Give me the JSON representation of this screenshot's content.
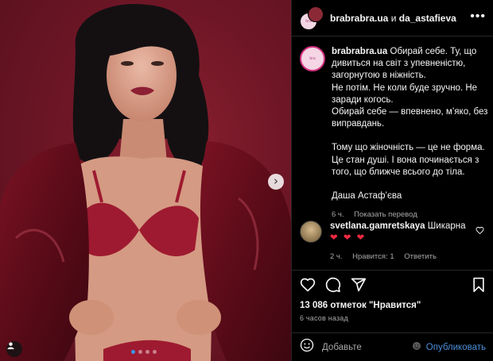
{
  "post": {
    "photo_alt": "",
    "next_glyph": "›",
    "slide_count": 4,
    "active_slide": 1
  },
  "header": {
    "user1": "brabrabra.ua",
    "joiner": "и",
    "user2": "da_astafieva",
    "more_glyph": "•••"
  },
  "caption": {
    "username": "brabrabra.ua",
    "paragraph1": [
      "Обирай себе. Ту, що дивиться на світ з упевненістю, загорнутою в ніжність.",
      "Не потім. Не коли буде зручно. Не заради когось.",
      "Обирай себе — впевнено, м’яко, без виправдань."
    ],
    "paragraph2": "Тому що жіночність — це не форма. Це стан душі. І вона починається з того, що ближче всього до тіла.",
    "signature": "Даша Астаф’єва",
    "age": "6 ч.",
    "translate": "Показать перевод"
  },
  "comment": {
    "username": "svetlana.gamretskaya",
    "text": "Шикарна",
    "hearts": "❤ ❤ ❤",
    "age": "2 ч.",
    "likes": "Нравится: 1",
    "reply": "Ответить"
  },
  "likes_text": "13 086 отметок \"Нравится\"",
  "timestamp": "6 часов назад",
  "add_comment": {
    "placeholder": "Добавьте",
    "post_label": "Опубликовать"
  },
  "icons": [
    "heart-icon",
    "comment-icon",
    "share-icon",
    "bookmark-icon",
    "emoji-icon",
    "user-tag-icon",
    "more-icon"
  ],
  "colors": {
    "background": "#000000",
    "accent": "#3897f0",
    "heart": "#ed2a41",
    "photo_bg": "#6e1626"
  }
}
